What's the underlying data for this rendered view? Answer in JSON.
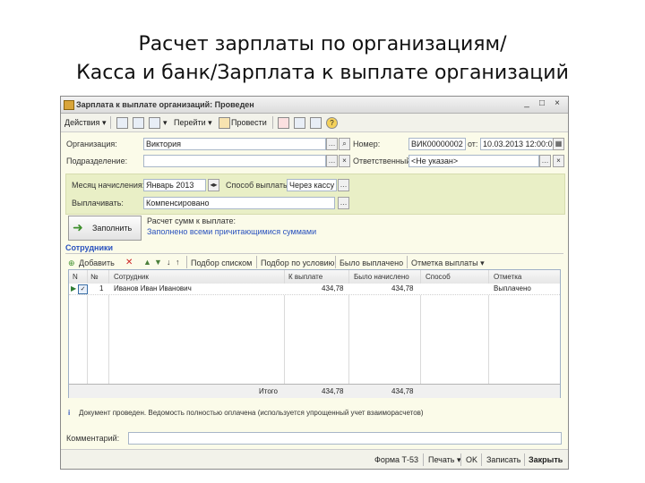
{
  "slide": {
    "title_line1": "Расчет зарплаты по организациям/",
    "title_line2": "Касса и банк/Зарплата к выплате организаций"
  },
  "window": {
    "title": "Зарплата к выплате организаций: Проведен",
    "controls": [
      "_",
      "□",
      "×"
    ]
  },
  "toolbar": {
    "actions": "Действия",
    "goto": "Перейти",
    "post": "Провести"
  },
  "form": {
    "org_label": "Организация:",
    "org_value": "Виктория",
    "dept_label": "Подразделение:",
    "dept_value": "",
    "number_label": "Номер:",
    "number_value": "ВИК00000002",
    "from_label": "от:",
    "date_value": "10.03.2013 12:00:00",
    "resp_label": "Ответственный:",
    "resp_value": "<Не указан>",
    "month_label": "Месяц начисления:",
    "month_value": "Январь 2013",
    "paymethod_label": "Способ выплаты:",
    "paymethod_value": "Через кассу",
    "payout_label": "Выплачивать:",
    "payout_value": "Компенсировано"
  },
  "fill_button": "Заполнить",
  "calc_info": {
    "line1": "Расчет сумм к выплате:",
    "line2": "Заполнено всеми причитающимися суммами"
  },
  "section_title": "Сотрудники",
  "table_toolbar": {
    "add": "Добавить",
    "select_list": "Подбор списком",
    "select_condition": "Подбор по условию",
    "paid_all": "Было выплачено",
    "mark_payout": "Отметка выплаты"
  },
  "table": {
    "headers": [
      "N",
      "№",
      "Сотрудник",
      "К выплате",
      "Было начислено",
      "Способ",
      "Отметка"
    ],
    "rows": [
      {
        "n": "1",
        "employee": "Иванов Иван Иванович",
        "to_pay": "434,78",
        "accrued": "434,78",
        "method": "",
        "mark": "Выплачено"
      }
    ],
    "footer_label": "Итого",
    "footer_to_pay": "434,78",
    "footer_accrued": "434,78"
  },
  "info_text": "Документ проведен. Ведомость полностью оплачена (используется упрощенный учет взаиморасчетов)",
  "comment_label": "Комментарий:",
  "comment_value": "",
  "statusbar": {
    "form": "Форма Т-53",
    "print": "Печать",
    "ok": "OK",
    "save": "Записать",
    "close": "Закрыть"
  },
  "colors": {
    "form_bg": "#fbfbe9",
    "group_bg": "#e9efc6",
    "link": "#2a52be"
  }
}
